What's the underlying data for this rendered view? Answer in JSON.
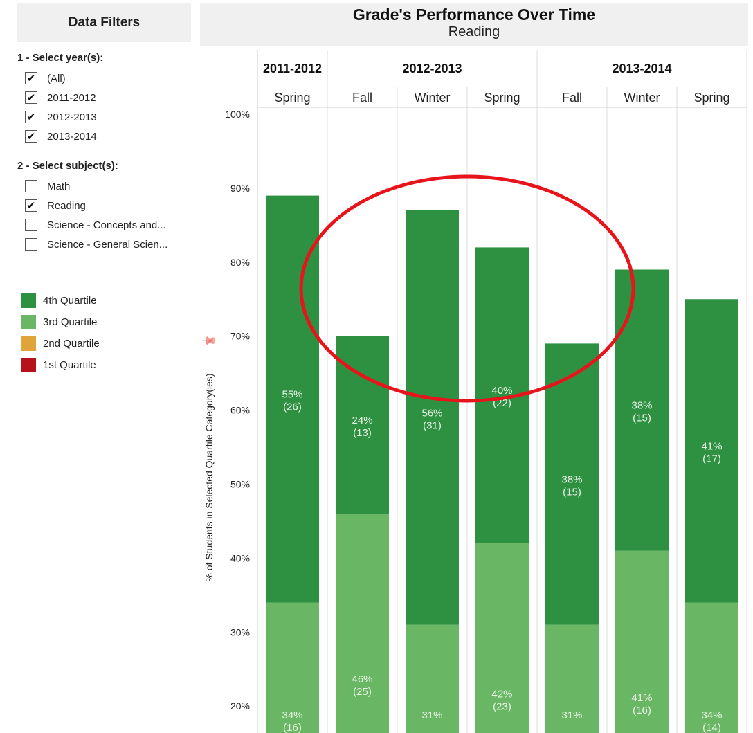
{
  "filters": {
    "title": "Data Filters",
    "year_label": "1 - Select year(s):",
    "years": [
      {
        "label": "(All)",
        "checked": true
      },
      {
        "label": "2011-2012",
        "checked": true
      },
      {
        "label": "2012-2013",
        "checked": true
      },
      {
        "label": "2013-2014",
        "checked": true
      }
    ],
    "subject_label": "2 - Select subject(s):",
    "subjects": [
      {
        "label": "Math",
        "checked": false
      },
      {
        "label": "Reading",
        "checked": true
      },
      {
        "label": "Science - Concepts and...",
        "checked": false
      },
      {
        "label": "Science - General Scien...",
        "checked": false
      }
    ]
  },
  "legend": [
    {
      "label": "4th Quartile",
      "color": "#2e9142"
    },
    {
      "label": "3rd Quartile",
      "color": "#69b764"
    },
    {
      "label": "2nd Quartile",
      "color": "#e0a53a"
    },
    {
      "label": "1st Quartile",
      "color": "#b5121b"
    }
  ],
  "chart_data": {
    "type": "bar",
    "stacked": true,
    "title": "Grade's Performance Over Time",
    "subtitle": "Reading",
    "ylabel": "% of Students in Selected Quartile Category(ies)",
    "ylim": [
      0,
      100
    ],
    "yticks": [
      "20%",
      "30%",
      "40%",
      "50%",
      "60%",
      "70%",
      "80%",
      "90%",
      "100%"
    ],
    "year_groups": [
      {
        "label": "2011-2012",
        "span": 1
      },
      {
        "label": "2012-2013",
        "span": 3
      },
      {
        "label": "2013-2014",
        "span": 3
      }
    ],
    "categories": [
      "Spring",
      "Fall",
      "Winter",
      "Spring",
      "Fall",
      "Winter",
      "Spring"
    ],
    "series": [
      {
        "name": "3rd Quartile",
        "color": "#69b764",
        "values": [
          34,
          46,
          31,
          42,
          31,
          41,
          34
        ],
        "labels": [
          "34%",
          "46%",
          "31%",
          "42%",
          "31%",
          "41%",
          "34%"
        ],
        "counts": [
          "(16)",
          "(25)",
          "",
          "(23)",
          "",
          "(16)",
          "(14)"
        ]
      },
      {
        "name": "4th Quartile",
        "color": "#2e9142",
        "values": [
          55,
          24,
          56,
          40,
          38,
          38,
          41
        ],
        "labels": [
          "55%",
          "24%",
          "56%",
          "40%",
          "38%",
          "38%",
          "41%"
        ],
        "counts": [
          "(26)",
          "(13)",
          "(31)",
          "(22)",
          "(15)",
          "(15)",
          "(17)"
        ]
      }
    ],
    "annotation": {
      "shape": "ellipse",
      "color": "#e8141b"
    }
  }
}
